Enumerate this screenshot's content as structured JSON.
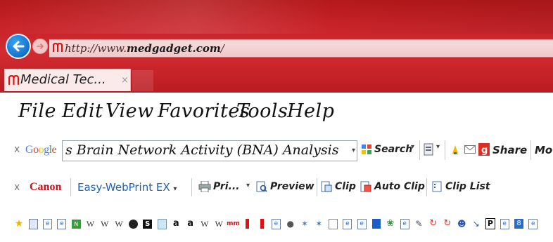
{
  "browser": {
    "address": {
      "prefix": "http://www.",
      "domain": "medgadget.com",
      "suffix": "/"
    },
    "tab": {
      "title": "Medical Tec...",
      "close": "×"
    }
  },
  "menu": [
    "File",
    "Edit",
    "View",
    "Favorites",
    "Tools",
    "Help"
  ],
  "google_toolbar": {
    "close": "x",
    "logo": "Google",
    "search_value": "s Brain Network Activity (BNA) Analysis",
    "search_button": "Search",
    "share_button": "Share",
    "more_button": "Mo"
  },
  "canon_toolbar": {
    "close": "x",
    "logo": "Canon",
    "product": "Easy-WebPrint EX",
    "print_button": "Pri...",
    "preview_button": "Preview",
    "clip_button": "Clip",
    "auto_clip_button": "Auto Clip",
    "clip_list_button": "Clip List"
  },
  "favorites_bar": {
    "items": [
      "star",
      "page",
      "ie",
      "ie",
      "ms",
      "w",
      "w",
      "w",
      "dark",
      "s",
      "doc",
      "amazon",
      "amazon",
      "w",
      "w",
      "mm",
      "bars",
      "bars",
      "ie",
      "apple",
      "bio",
      "bio",
      "book",
      "ie",
      "ie",
      "bookmark",
      "leaf",
      "ie",
      "pen",
      "redo",
      "redo",
      "people",
      "arrow",
      "p",
      "ie",
      "8",
      "ie"
    ]
  },
  "colors": {
    "accent": "#c8242a",
    "google_blue": "#4285f4",
    "canon_red": "#c8101a",
    "ewp_blue": "#1d63b8"
  }
}
